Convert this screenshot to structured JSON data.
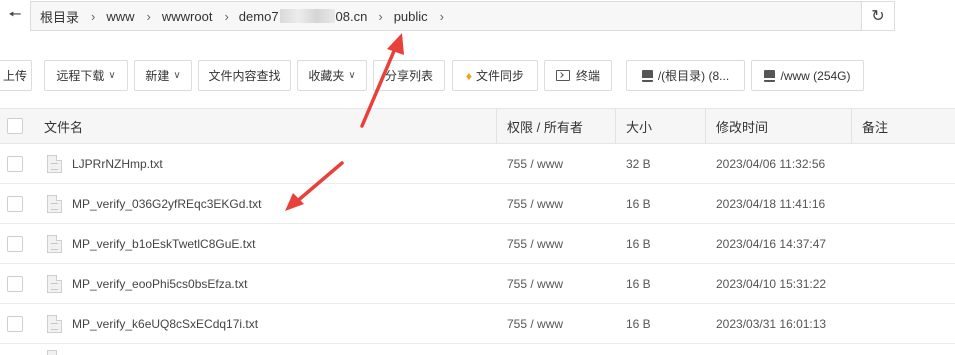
{
  "breadcrumb": {
    "root": "根目录",
    "segments": [
      "www",
      "wwwroot"
    ],
    "domain_prefix": "demo7",
    "domain_suffix": "08.cn",
    "current": "public"
  },
  "toolbar": {
    "upload": "上传",
    "remote_download": "远程下载",
    "new": "新建",
    "content_search": "文件内容查找",
    "favorites": "收藏夹",
    "share_list": "分享列表",
    "file_sync": "文件同步",
    "terminal": "终端",
    "disk_root": "/(根目录) (8...",
    "disk_www": "/www (254G)"
  },
  "table": {
    "headers": {
      "name": "文件名",
      "perm_owner": "权限 / 所有者",
      "size": "大小",
      "modified": "修改时间",
      "note": "备注"
    },
    "rows": [
      {
        "name": "LJPRrNZHmp.txt",
        "perm": "755 / www",
        "size": "32 B",
        "modified": "2023/04/06 11:32:56"
      },
      {
        "name": "MP_verify_036G2yfREqc3EKGd.txt",
        "perm": "755 / www",
        "size": "16 B",
        "modified": "2023/04/18 11:41:16"
      },
      {
        "name": "MP_verify_b1oEskTwetlC8GuE.txt",
        "perm": "755 / www",
        "size": "16 B",
        "modified": "2023/04/16 14:37:47"
      },
      {
        "name": "MP_verify_eooPhi5cs0bsEfza.txt",
        "perm": "755 / www",
        "size": "16 B",
        "modified": "2023/04/10 15:31:22"
      },
      {
        "name": "MP_verify_k6eUQ8cSxECdq17i.txt",
        "perm": "755 / www",
        "size": "16 B",
        "modified": "2023/03/31 16:01:13"
      }
    ]
  },
  "colors": {
    "annotation_arrow": "#e8413b",
    "accent_gem": "#f0a020"
  }
}
